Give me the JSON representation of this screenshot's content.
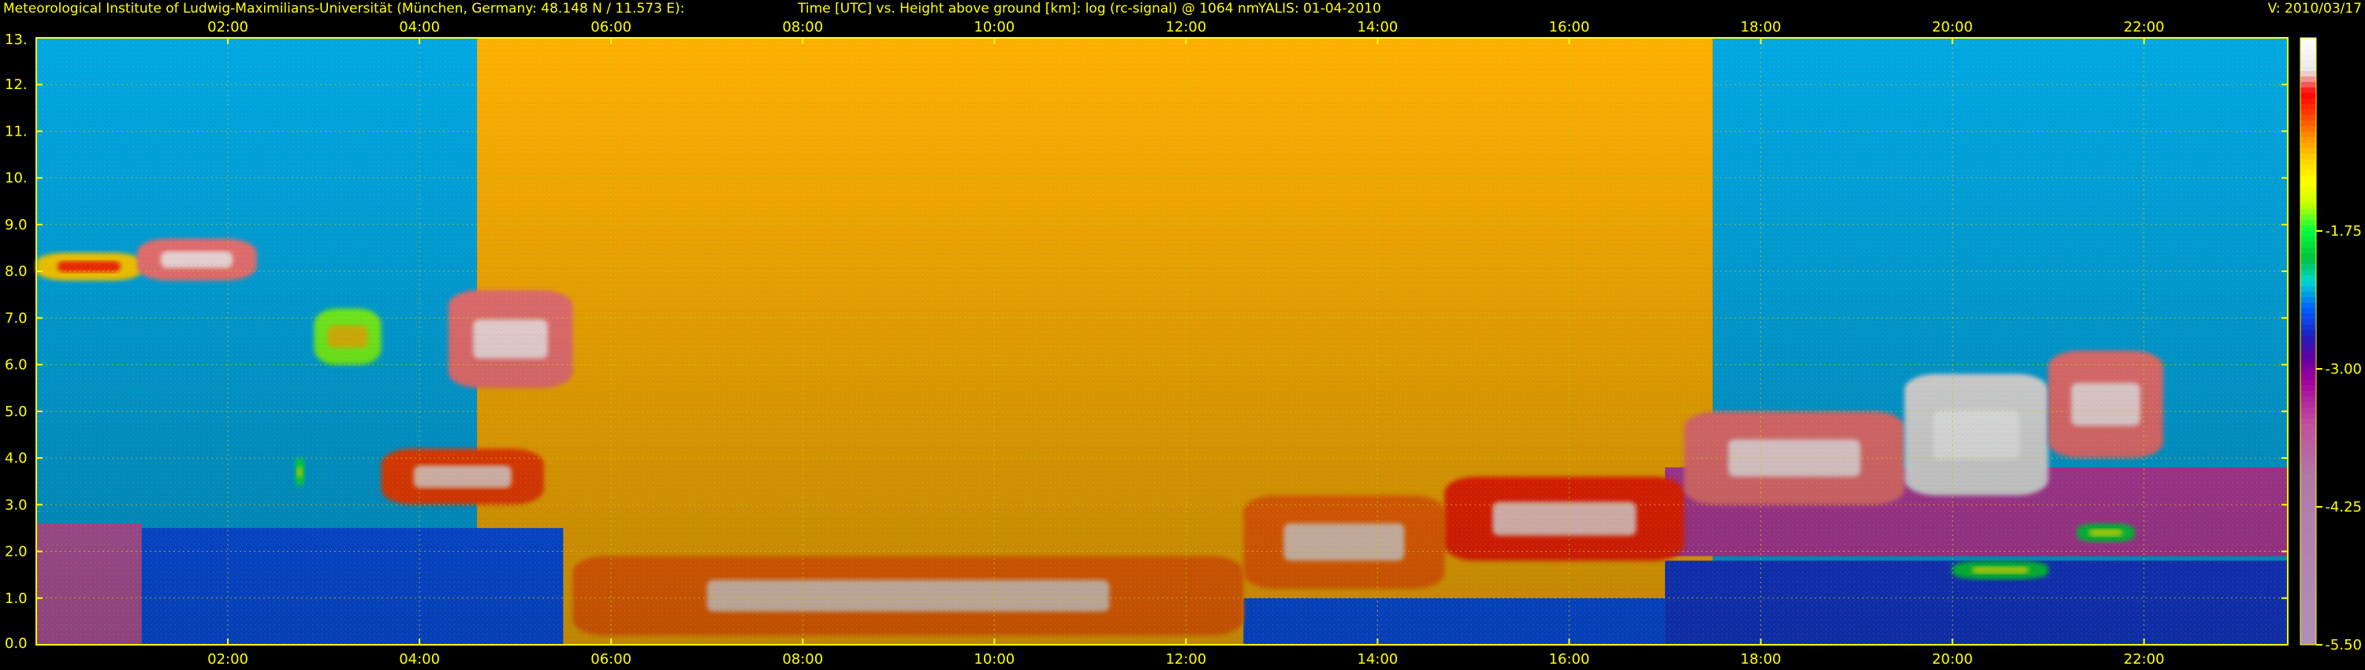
{
  "header": {
    "institute": "Meteorological Institute of Ludwig-Maximilians-Universität (München, Germany: 48.148 N / 11.573 E):",
    "title": "Time [UTC] vs. Height above ground [km]: log (rc-signal) @ 1064 nm",
    "instrument_date": "YALIS: 01-04-2010",
    "version": "V: 2010/03/17"
  },
  "colors": {
    "text": "#ffff00",
    "frame": "#ffff00",
    "grid": "#c8c800",
    "background": "#000000"
  },
  "chart_data": {
    "type": "heatmap",
    "title": "Time [UTC] vs. Height above ground [km]: log (rc-signal) @ 1064 nm",
    "xlabel": "",
    "ylabel": "",
    "x_unit": "Time [UTC] (hours)",
    "y_unit": "Height above ground [km]",
    "xlim": [
      0.0,
      23.5
    ],
    "ylim": [
      0,
      13
    ],
    "grid": true,
    "x_ticks": [
      {
        "value": 2,
        "label": "02:00"
      },
      {
        "value": 4,
        "label": "04:00"
      },
      {
        "value": 6,
        "label": "06:00"
      },
      {
        "value": 8,
        "label": "08:00"
      },
      {
        "value": 10,
        "label": "10:00"
      },
      {
        "value": 12,
        "label": "12:00"
      },
      {
        "value": 14,
        "label": "14:00"
      },
      {
        "value": 16,
        "label": "16:00"
      },
      {
        "value": 18,
        "label": "18:00"
      },
      {
        "value": 20,
        "label": "20:00"
      },
      {
        "value": 22,
        "label": "22:00"
      }
    ],
    "y_ticks": [
      {
        "value": 0,
        "label": "0.0"
      },
      {
        "value": 1,
        "label": "1.0"
      },
      {
        "value": 2,
        "label": "2.0"
      },
      {
        "value": 3,
        "label": "3.0"
      },
      {
        "value": 4,
        "label": "4.0"
      },
      {
        "value": 5,
        "label": "5.0"
      },
      {
        "value": 6,
        "label": "6.0"
      },
      {
        "value": 7,
        "label": "7.0"
      },
      {
        "value": 8,
        "label": "8.0"
      },
      {
        "value": 9,
        "label": "9.0"
      },
      {
        "value": 10,
        "label": "10."
      },
      {
        "value": 11,
        "label": "11."
      },
      {
        "value": 12,
        "label": "12."
      },
      {
        "value": 13,
        "label": "13."
      }
    ],
    "colorbar": {
      "min": -5.5,
      "max": 0,
      "ticks": [
        {
          "value": -1.75,
          "label": "-1.75"
        },
        {
          "value": -3.0,
          "label": "-3.00"
        },
        {
          "value": -4.25,
          "label": "-4.25"
        },
        {
          "value": -5.5,
          "label": "-5.50"
        }
      ],
      "stops": [
        {
          "value": 0.0,
          "color": "#ffffff"
        },
        {
          "value": -0.3,
          "color": "#e8e8e8"
        },
        {
          "value": -0.5,
          "color": "#ff0000"
        },
        {
          "value": -0.7,
          "color": "#ff4000"
        },
        {
          "value": -0.9,
          "color": "#ff9000"
        },
        {
          "value": -1.1,
          "color": "#ffd000"
        },
        {
          "value": -1.3,
          "color": "#ffff00"
        },
        {
          "value": -1.5,
          "color": "#c8ff00"
        },
        {
          "value": -1.75,
          "color": "#00ff40"
        },
        {
          "value": -2.0,
          "color": "#00c040"
        },
        {
          "value": -2.2,
          "color": "#00d8d0"
        },
        {
          "value": -2.45,
          "color": "#0060ff"
        },
        {
          "value": -2.7,
          "color": "#2020c0"
        },
        {
          "value": -2.9,
          "color": "#6000a0"
        },
        {
          "value": -3.1,
          "color": "#a000a0"
        },
        {
          "value": -3.5,
          "color": "#c050a0"
        },
        {
          "value": -4.0,
          "color": "#b07aa8"
        },
        {
          "value": -5.5,
          "color": "#b090b8"
        }
      ]
    },
    "features": [
      {
        "kind": "background_noise",
        "x": [
          0.0,
          4.6
        ],
        "y": [
          0,
          13
        ],
        "level": -2.3
      },
      {
        "kind": "daylight_noise",
        "x": [
          4.6,
          17.5
        ],
        "y": [
          0,
          13
        ],
        "level": -1.0
      },
      {
        "kind": "background_noise",
        "x": [
          17.5,
          23.5
        ],
        "y": [
          0,
          13
        ],
        "level": -2.3
      },
      {
        "kind": "boundary_layer",
        "x": [
          0.0,
          1.1
        ],
        "y": [
          0.0,
          2.6
        ],
        "level": -3.6
      },
      {
        "kind": "boundary_layer",
        "x": [
          1.1,
          5.5
        ],
        "y": [
          0.0,
          2.5
        ],
        "level": -2.5
      },
      {
        "kind": "boundary_layer",
        "x": [
          12.6,
          17.0
        ],
        "y": [
          0.0,
          1.0
        ],
        "level": -2.5
      },
      {
        "kind": "boundary_layer",
        "x": [
          17.0,
          23.5
        ],
        "y": [
          0.0,
          1.8
        ],
        "level": -2.6
      },
      {
        "kind": "boundary_layer",
        "x": [
          17.0,
          23.5
        ],
        "y": [
          1.9,
          3.8
        ],
        "level": -3.4
      },
      {
        "kind": "cloud",
        "x": [
          0.0,
          1.1
        ],
        "y": [
          7.8,
          8.4
        ],
        "level": -1.1
      },
      {
        "kind": "cloud",
        "x": [
          1.05,
          2.3
        ],
        "y": [
          7.8,
          8.7
        ],
        "level": -0.4
      },
      {
        "kind": "cloud",
        "x": [
          2.9,
          3.6
        ],
        "y": [
          6.0,
          7.2
        ],
        "level": -1.6
      },
      {
        "kind": "cloud",
        "x": [
          4.3,
          5.6
        ],
        "y": [
          5.5,
          7.6
        ],
        "level": -0.4
      },
      {
        "kind": "cloud",
        "x": [
          3.6,
          5.3
        ],
        "y": [
          3.0,
          4.2
        ],
        "level": -0.7
      },
      {
        "kind": "cloud",
        "x": [
          2.7,
          2.8
        ],
        "y": [
          3.4,
          4.0
        ],
        "level": -1.8
      },
      {
        "kind": "cloud",
        "x": [
          5.6,
          12.6
        ],
        "y": [
          0.2,
          1.9
        ],
        "level": -0.8
      },
      {
        "kind": "cloud",
        "x": [
          12.6,
          14.7
        ],
        "y": [
          1.2,
          3.2
        ],
        "level": -0.8
      },
      {
        "kind": "cloud",
        "x": [
          14.7,
          17.2
        ],
        "y": [
          1.8,
          3.6
        ],
        "level": -0.6
      },
      {
        "kind": "cloud",
        "x": [
          17.2,
          19.5
        ],
        "y": [
          3.0,
          5.0
        ],
        "level": -0.4
      },
      {
        "kind": "cloud",
        "x": [
          19.5,
          21.0
        ],
        "y": [
          3.2,
          5.8
        ],
        "level": -0.3
      },
      {
        "kind": "cloud",
        "x": [
          21.0,
          22.2
        ],
        "y": [
          4.0,
          6.3
        ],
        "level": -0.4
      },
      {
        "kind": "cloud",
        "x": [
          21.3,
          21.9
        ],
        "y": [
          2.2,
          2.6
        ],
        "level": -1.9
      },
      {
        "kind": "cloud",
        "x": [
          20.0,
          21.0
        ],
        "y": [
          1.4,
          1.8
        ],
        "level": -1.9
      }
    ]
  }
}
